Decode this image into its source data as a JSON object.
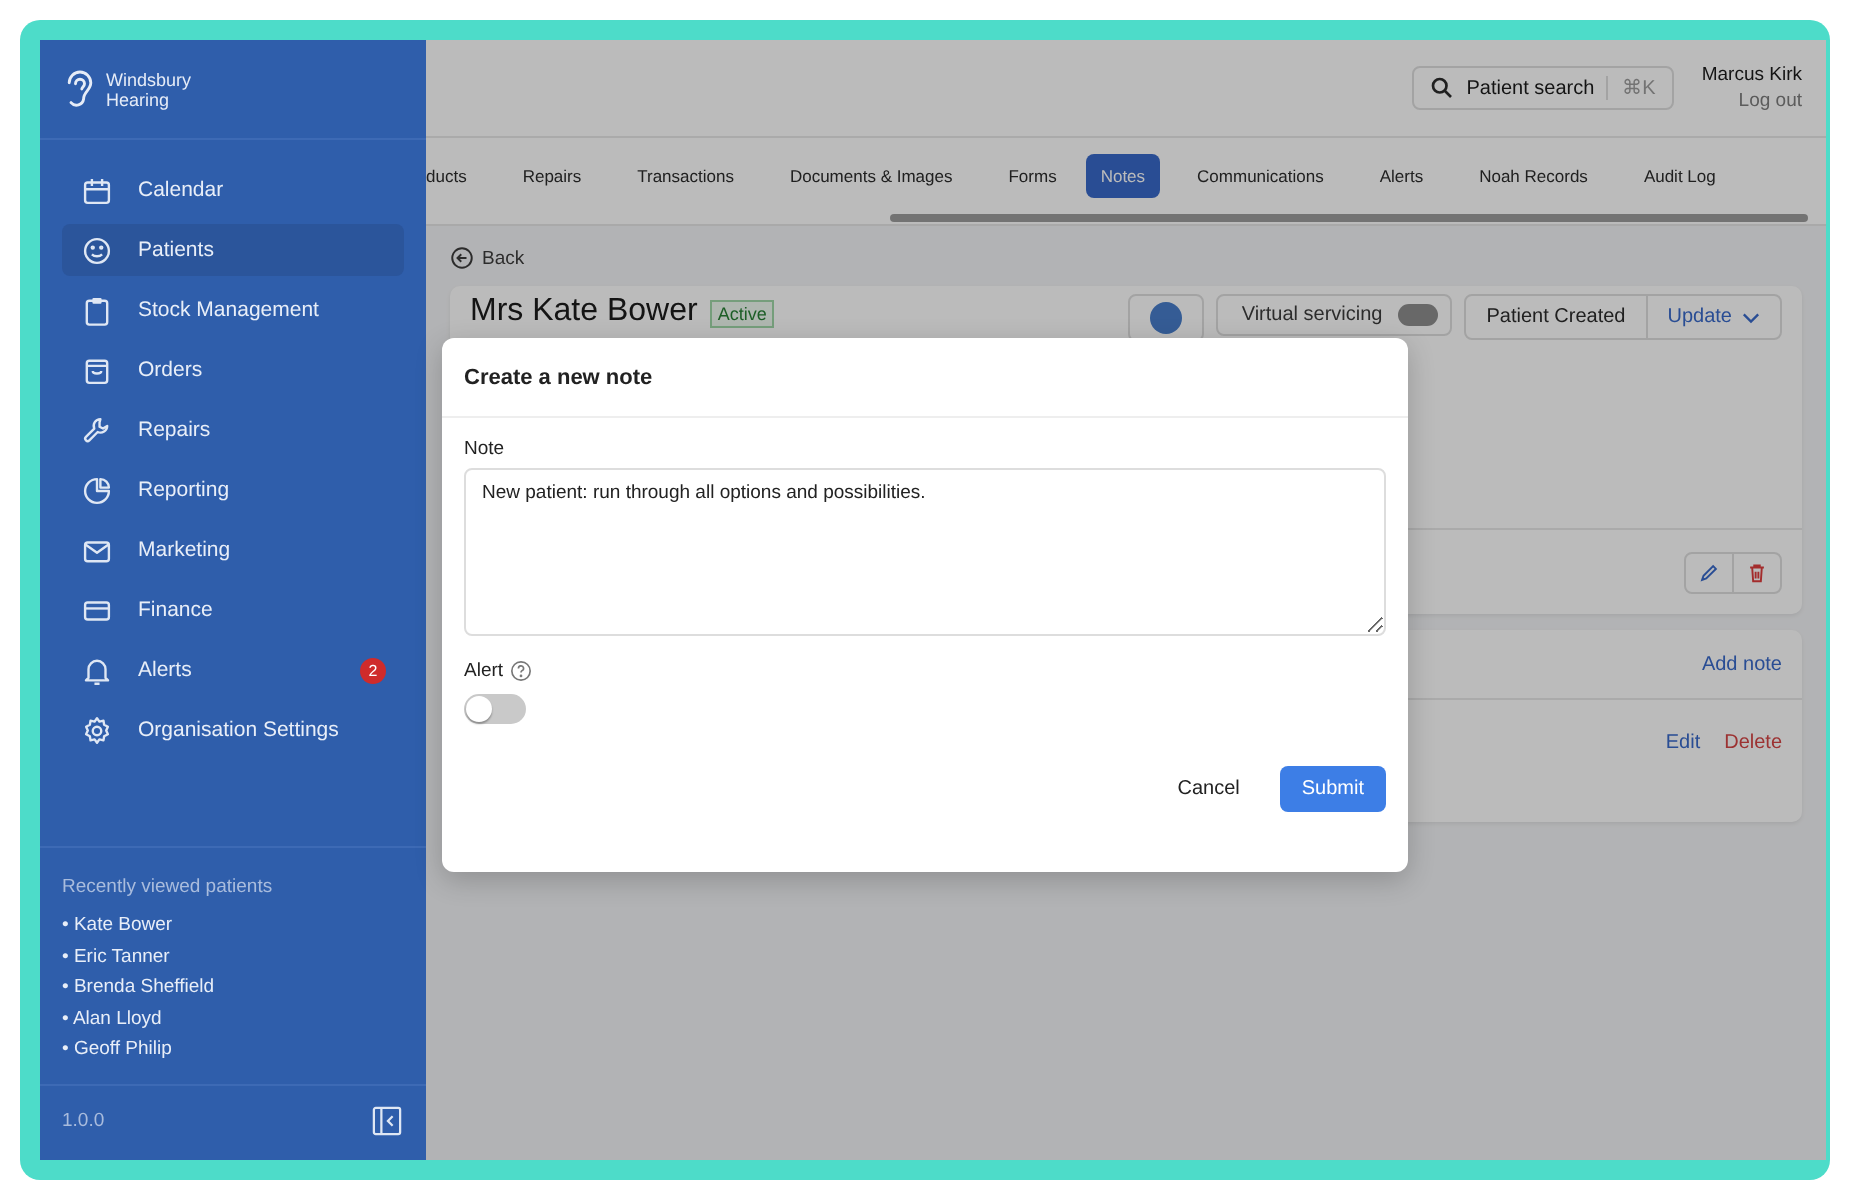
{
  "brand": {
    "line1": "Windsbury",
    "line2": "Hearing"
  },
  "nav": [
    {
      "label": "Calendar",
      "selected": false
    },
    {
      "label": "Patients",
      "selected": true
    },
    {
      "label": "Stock Management",
      "selected": false
    },
    {
      "label": "Orders",
      "selected": false
    },
    {
      "label": "Repairs",
      "selected": false
    },
    {
      "label": "Reporting",
      "selected": false
    },
    {
      "label": "Marketing",
      "selected": false
    },
    {
      "label": "Finance",
      "selected": false
    },
    {
      "label": "Alerts",
      "selected": false,
      "badge": "2"
    },
    {
      "label": "Organisation Settings",
      "selected": false
    }
  ],
  "recent": {
    "title": "Recently viewed patients",
    "items": [
      "• Kate Bower",
      "• Eric Tanner",
      "• Brenda Sheffield",
      "• Alan Lloyd",
      "• Geoff Philip"
    ]
  },
  "version": "1.0.0",
  "search": {
    "label": "Patient search",
    "shortcut": "⌘K"
  },
  "user": {
    "name": "Marcus Kirk",
    "logout": "Log out"
  },
  "tabs": [
    {
      "label": "ducts",
      "selected": false
    },
    {
      "label": "Repairs",
      "selected": false
    },
    {
      "label": "Transactions",
      "selected": false
    },
    {
      "label": "Documents & Images",
      "selected": false
    },
    {
      "label": "Forms",
      "selected": false
    },
    {
      "label": "Notes",
      "selected": true
    },
    {
      "label": "Communications",
      "selected": false
    },
    {
      "label": "Alerts",
      "selected": false
    },
    {
      "label": "Noah Records",
      "selected": false
    },
    {
      "label": "Audit Log",
      "selected": false
    }
  ],
  "back": "Back",
  "patient": {
    "name": "Mrs Kate Bower",
    "status": "Active",
    "virtual_servicing": {
      "label": "Virtual servicing",
      "on": false
    },
    "created": "Patient Created",
    "update": "Update"
  },
  "notes_card": {
    "add": "Add note",
    "edit": "Edit",
    "delete": "Delete"
  },
  "modal": {
    "title": "Create a new note",
    "note_label": "Note",
    "note_value": "New patient: run through all options and possibilities.",
    "alert_label": "Alert",
    "alert_on": false,
    "cancel": "Cancel",
    "submit": "Submit"
  }
}
